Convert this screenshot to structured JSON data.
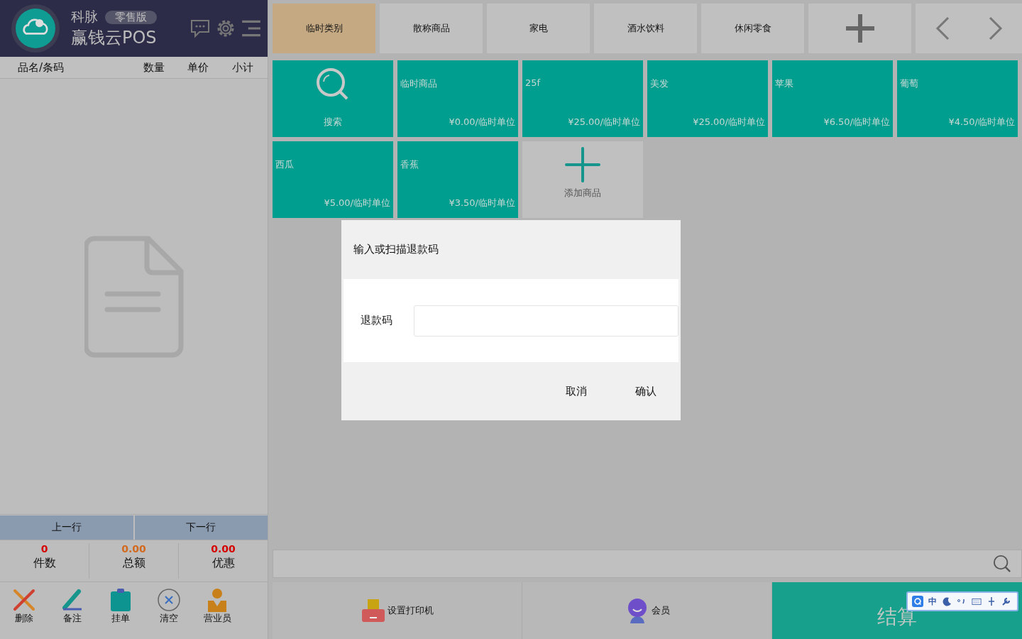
{
  "header": {
    "brand": "科脉",
    "edition": "零售版",
    "product": "赢钱云POS"
  },
  "list_columns": [
    "品名/条码",
    "数量",
    "单价",
    "小计"
  ],
  "nav_buttons": [
    "上一行",
    "下一行"
  ],
  "stats": [
    {
      "value": "0",
      "label": "件数",
      "color": "#d50000"
    },
    {
      "value": "0.00",
      "label": "总额",
      "color": "#d2691e"
    },
    {
      "value": "0.00",
      "label": "优惠",
      "color": "#d50000"
    }
  ],
  "actions": [
    {
      "kind": "delete",
      "label": "删除"
    },
    {
      "kind": "note",
      "label": "备注"
    },
    {
      "kind": "hold",
      "label": "挂单"
    },
    {
      "kind": "clear",
      "label": "清空"
    },
    {
      "kind": "staff",
      "label": "营业员"
    }
  ],
  "categories": [
    {
      "label": "临时类别",
      "selected": true
    },
    {
      "label": "散称商品",
      "selected": false
    },
    {
      "label": "家电",
      "selected": false
    },
    {
      "label": "酒水饮料",
      "selected": false
    },
    {
      "label": "休闲零食",
      "selected": false
    }
  ],
  "products": [
    {
      "kind": "search",
      "name": "搜索"
    },
    {
      "kind": "product",
      "name": "临时商品",
      "price": "¥0.00/临时单位"
    },
    {
      "kind": "product",
      "name": "25f",
      "price": "¥25.00/临时单位"
    },
    {
      "kind": "product",
      "name": "美发",
      "price": "¥25.00/临时单位"
    },
    {
      "kind": "product",
      "name": "苹果",
      "price": "¥6.50/临时单位"
    },
    {
      "kind": "product",
      "name": "葡萄",
      "price": "¥4.50/临时单位"
    },
    {
      "kind": "product",
      "name": "西瓜",
      "price": "¥5.00/临时单位"
    },
    {
      "kind": "product",
      "name": "香蕉",
      "price": "¥3.50/临时单位"
    },
    {
      "kind": "add",
      "name": "添加商品"
    }
  ],
  "bottom": {
    "printer": "设置打印机",
    "member": "会员",
    "checkout": "结算"
  },
  "dialog": {
    "title": "输入或扫描退款码",
    "field_label": "退款码",
    "buttons": [
      "取消",
      "确认"
    ]
  },
  "ime": {
    "label": "中"
  }
}
